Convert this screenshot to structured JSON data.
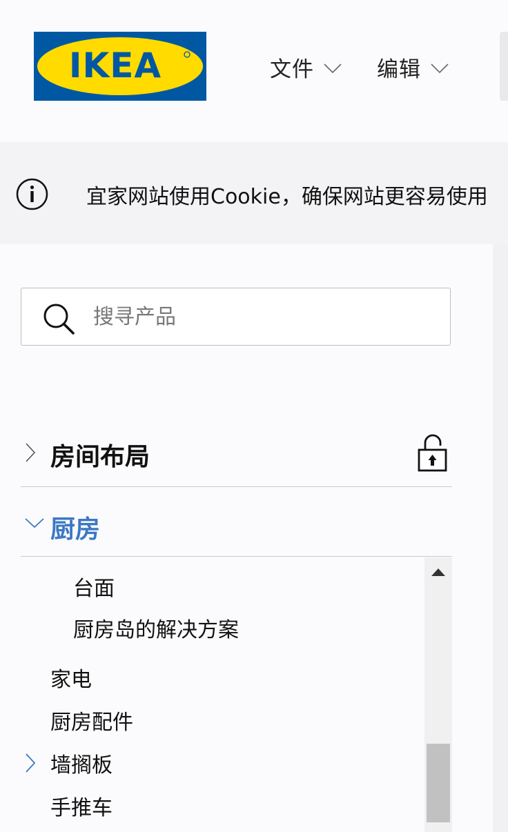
{
  "header": {
    "logo_text": "IKEA",
    "menus": [
      {
        "label": "文件"
      },
      {
        "label": "编辑"
      }
    ]
  },
  "cookie_banner": {
    "text": "宜家网站使用Cookie，确保网站更容易使用"
  },
  "search": {
    "placeholder": "搜寻产品"
  },
  "nav": {
    "room_layout": {
      "label": "房间布局"
    },
    "kitchen": {
      "label": "厨房"
    }
  },
  "kitchen_list": {
    "items": [
      {
        "label": "台面"
      },
      {
        "label": "厨房岛的解决方案"
      },
      {
        "label": "家电"
      },
      {
        "label": "厨房配件"
      },
      {
        "label": "墙搁板"
      },
      {
        "label": "手推车"
      }
    ]
  },
  "colors": {
    "brand_blue": "#0058a3",
    "brand_yellow": "#ffdb00",
    "active_blue": "#3c78c3"
  }
}
